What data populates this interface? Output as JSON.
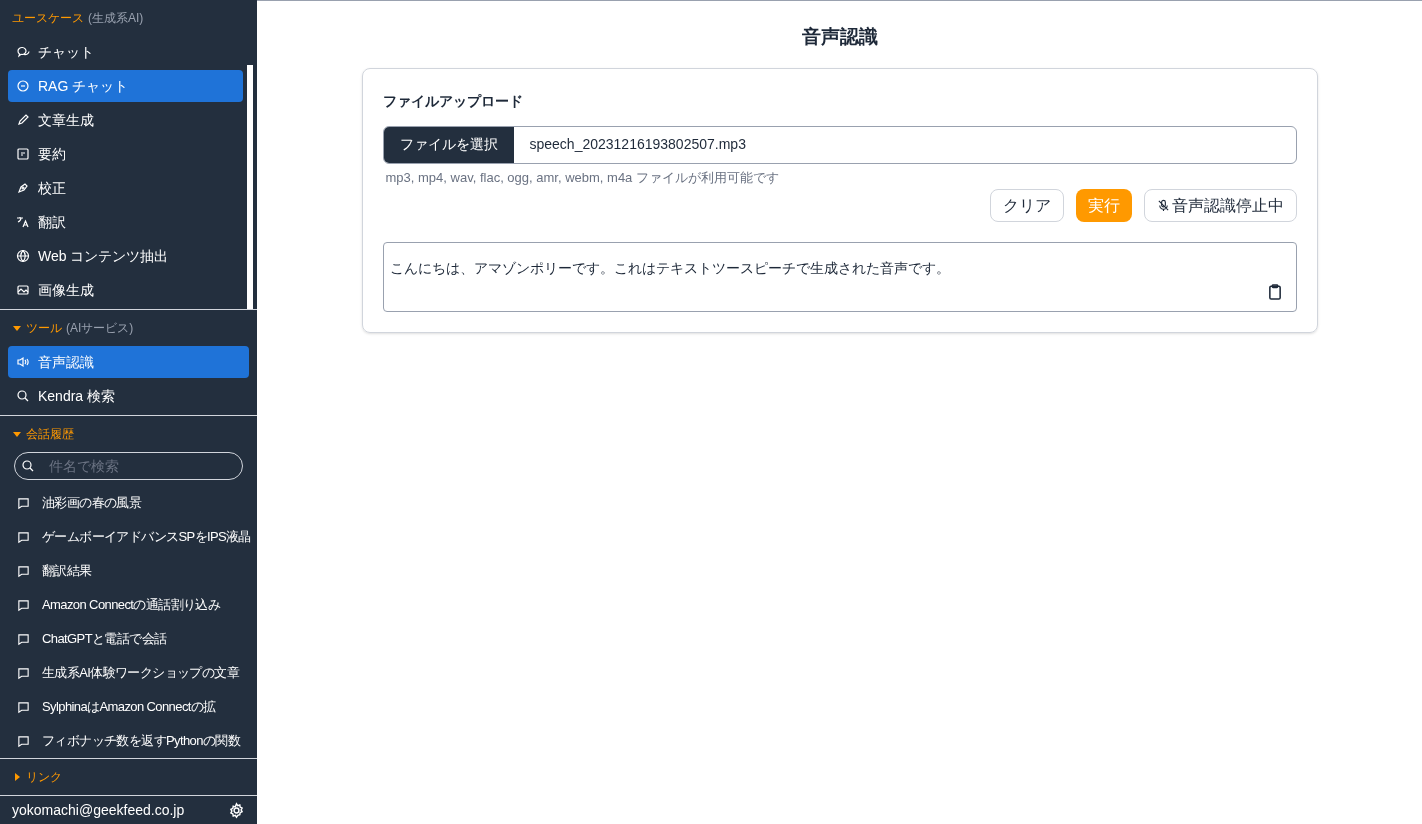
{
  "sidebar": {
    "sections": [
      {
        "title": "ユースケース",
        "subtitle": "(生成系AI)",
        "items": [
          {
            "label": "チャット",
            "selected": false
          },
          {
            "label": "RAG チャット",
            "selected": true
          },
          {
            "label": "文章生成",
            "selected": false
          },
          {
            "label": "要約",
            "selected": false
          },
          {
            "label": "校正",
            "selected": false
          },
          {
            "label": "翻訳",
            "selected": false
          },
          {
            "label": "Web コンテンツ抽出",
            "selected": false
          },
          {
            "label": "画像生成",
            "selected": false
          }
        ]
      },
      {
        "title": "ツール",
        "subtitle": "(AIサービス)",
        "expanded": true,
        "items": [
          {
            "label": "音声認識",
            "selected": true
          },
          {
            "label": "Kendra 検索",
            "selected": false
          }
        ]
      }
    ],
    "history": {
      "title": "会話履歴",
      "expanded": true,
      "search": {
        "placeholder": "件名で検索"
      },
      "items": [
        "油彩画の春の風景",
        "ゲームボーイアドバンスSPをIPS液晶",
        "翻訳結果",
        "Amazon Connectの通話割り込み",
        "ChatGPTと電話で会話",
        "生成系AI体験ワークショップの文章",
        "SylphinaはAmazon Connectの拡",
        "フィボナッチ数を返すPythonの関数"
      ]
    },
    "links": {
      "title": "リンク",
      "expanded": false
    },
    "user": {
      "email": "yokomachi@geekfeed.co.jp"
    }
  },
  "main": {
    "title": "音声認識",
    "upload": {
      "label": "ファイルアップロード",
      "choose_button": "ファイルを選択",
      "file_name": "speech_20231216193802507.mp3",
      "hint": "mp3, mp4, wav, flac, ogg, amr, webm, m4a ファイルが利用可能です"
    },
    "buttons": [
      {
        "label": "クリア",
        "kind": "outline"
      },
      {
        "label": "実行",
        "kind": "primary"
      },
      {
        "label": "音声認識停止中",
        "kind": "mic"
      }
    ],
    "result": "こんにちは、アマゾンポリーです。これはテキストツースピーチで生成された音声です。"
  }
}
